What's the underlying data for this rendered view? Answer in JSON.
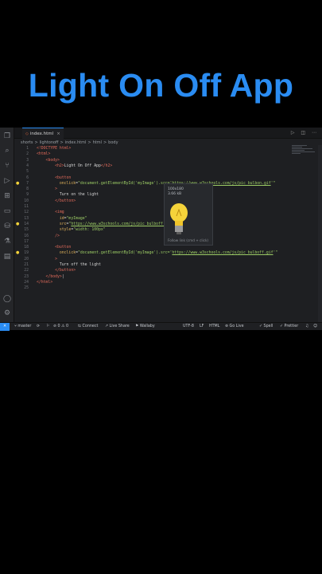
{
  "title": "Light On Off App",
  "editor": {
    "tab": {
      "filename": "index.html",
      "close": "×"
    },
    "tab_actions": "▷ ◫ ⋯",
    "breadcrumb": [
      "shorts",
      ">",
      "lightonoff",
      ">",
      "index.html",
      ">",
      "html",
      ">",
      "body"
    ],
    "line_numbers": [
      "1",
      "2",
      "3",
      "4",
      "5",
      "6",
      "7",
      "8",
      "9",
      "10",
      "11",
      "12",
      "13",
      "14",
      "15",
      "16",
      "17",
      "18",
      "19",
      "20",
      "21",
      "22",
      "23",
      "24",
      "25"
    ],
    "lines": [
      [
        {
          "c": "tag",
          "t": "<!DOCTYPE html>"
        }
      ],
      [
        {
          "c": "tag",
          "t": "<html>"
        }
      ],
      [
        {
          "c": "tag",
          "t": "    <body>"
        }
      ],
      [
        {
          "c": "tag",
          "t": "        <h2>"
        },
        {
          "c": "txt",
          "t": "Light On Off App"
        },
        {
          "c": "tag",
          "t": "</h2>"
        }
      ],
      [],
      [
        {
          "c": "tag",
          "t": "        <button"
        }
      ],
      [
        {
          "c": "attr",
          "t": "          onclick"
        },
        {
          "c": "txt",
          "t": "="
        },
        {
          "c": "str",
          "t": "\"document.getElementById('myImage').src='"
        },
        {
          "c": "link",
          "t": "https://www.w3schools.com/js/pic_bulbon.gif"
        },
        {
          "c": "str",
          "t": "'\""
        }
      ],
      [
        {
          "c": "tag",
          "t": "        >"
        }
      ],
      [
        {
          "c": "txt",
          "t": "          Turn on the light"
        }
      ],
      [
        {
          "c": "tag",
          "t": "        </button>"
        }
      ],
      [],
      [
        {
          "c": "tag",
          "t": "        <img"
        }
      ],
      [
        {
          "c": "attr",
          "t": "          id"
        },
        {
          "c": "txt",
          "t": "="
        },
        {
          "c": "str",
          "t": "\"myImage\""
        }
      ],
      [
        {
          "c": "attr",
          "t": "          src"
        },
        {
          "c": "txt",
          "t": "="
        },
        {
          "c": "str",
          "t": "\""
        },
        {
          "c": "link",
          "t": "https://www.w3schools.com/js/pic_bulboff.gif"
        },
        {
          "c": "str",
          "t": "\""
        }
      ],
      [
        {
          "c": "attr",
          "t": "          style"
        },
        {
          "c": "txt",
          "t": "="
        },
        {
          "c": "str",
          "t": "\"width: 100px\""
        }
      ],
      [
        {
          "c": "tag",
          "t": "        />"
        }
      ],
      [],
      [
        {
          "c": "tag",
          "t": "        <button"
        }
      ],
      [
        {
          "c": "attr",
          "t": "          onclick"
        },
        {
          "c": "txt",
          "t": "="
        },
        {
          "c": "str",
          "t": "\"document.getElementById('myImage').src='"
        },
        {
          "c": "link",
          "t": "https://www.w3schools.com/js/pic_bulboff.gif"
        },
        {
          "c": "str",
          "t": "'\""
        }
      ],
      [
        {
          "c": "tag",
          "t": "        >"
        }
      ],
      [
        {
          "c": "txt",
          "t": "          Turn off the light"
        }
      ],
      [
        {
          "c": "tag",
          "t": "        </button>"
        }
      ],
      [
        {
          "c": "tag",
          "t": "    </body>"
        },
        {
          "c": "txt",
          "t": "|"
        }
      ],
      [
        {
          "c": "tag",
          "t": "</html>"
        }
      ],
      []
    ],
    "hover": {
      "dimensions": "100x180",
      "size": "3.66 kB",
      "footer": "Follow link (cmd + click)"
    },
    "colors": {
      "accent": "#2a8cf2",
      "bulb": "#f5d33a"
    }
  },
  "statusbar": {
    "remote": "✕",
    "branch": "master",
    "sync": "⟳",
    "problems": "⊘ 0 ⚠ 0",
    "connect": "Connect",
    "liveshare": "Live Share",
    "wallaby": "Wallaby",
    "encoding": "UTF-8",
    "eol": "LF",
    "language": "HTML",
    "golive": "Go Live",
    "spell": "Spell",
    "prettier": "Prettier"
  }
}
